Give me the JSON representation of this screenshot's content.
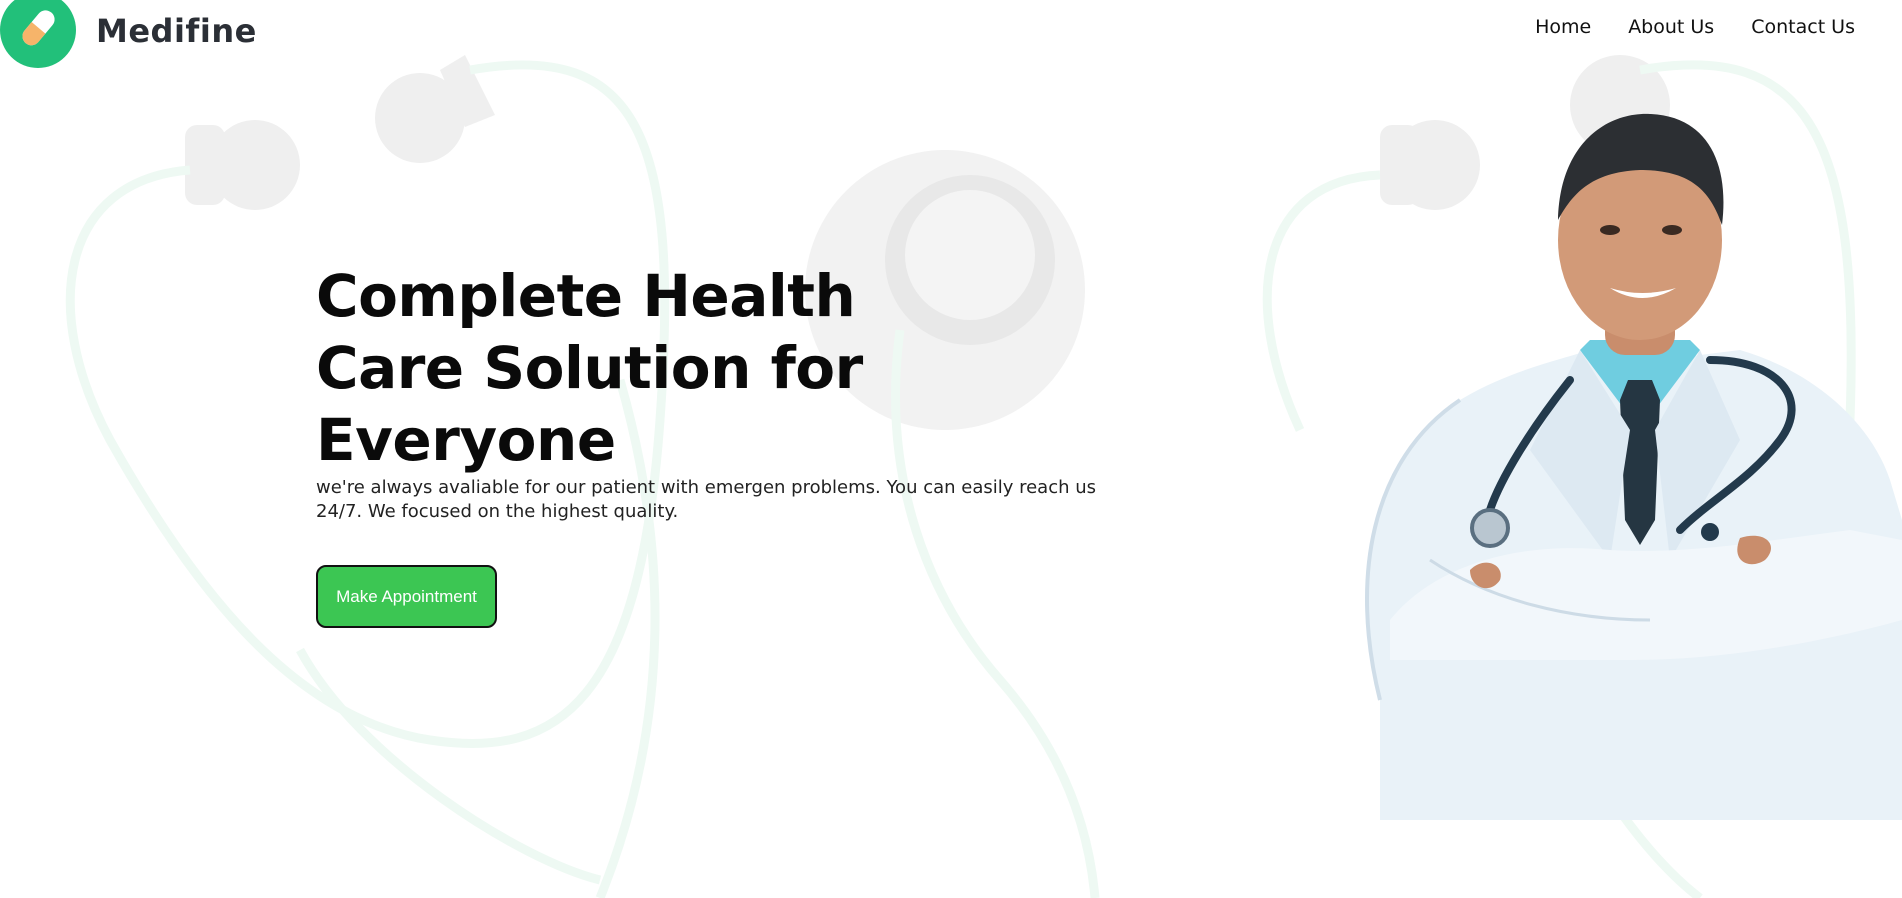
{
  "brand": {
    "name": "Medifine",
    "icon": "pill-icon",
    "color": "#22c07a"
  },
  "nav": {
    "items": [
      "Home",
      "About Us",
      "Contact Us"
    ]
  },
  "hero": {
    "title": "Complete Health Care Solution for Everyone",
    "description": "we're always avaliable for our patient with emergen problems. You can easily reach us 24/7. We focused on the highest quality.",
    "cta_label": "Make Appointment",
    "cta_color": "#3cc653"
  },
  "image": {
    "subject": "doctor-photo"
  }
}
